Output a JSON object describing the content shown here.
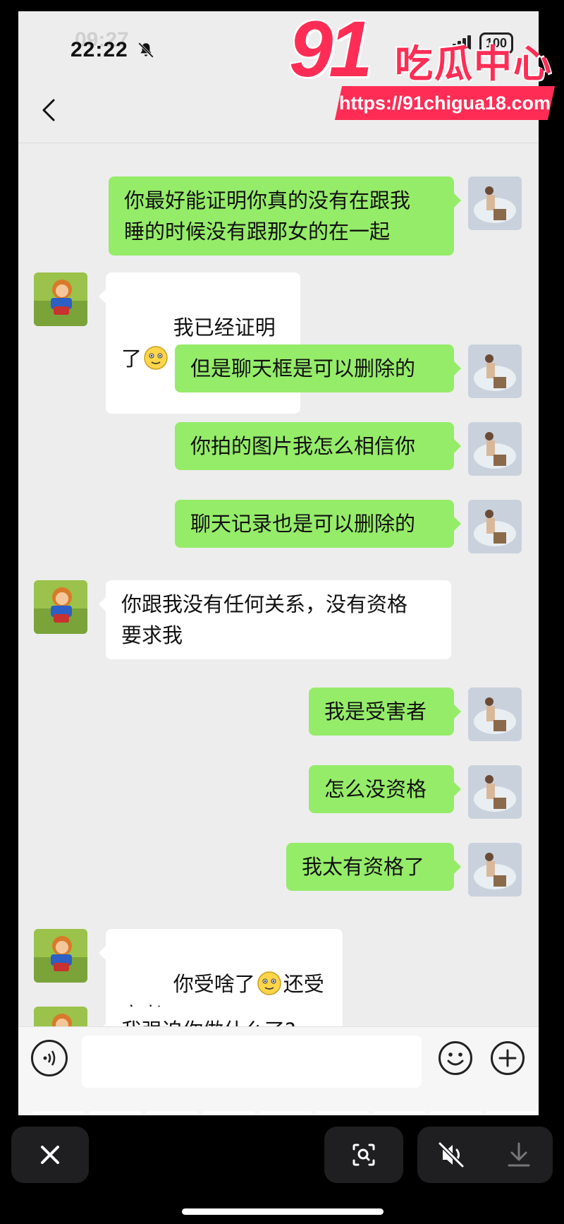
{
  "status": {
    "time": "22:22",
    "time_ghost": "09:27",
    "battery": "100"
  },
  "watermark": {
    "number": "91",
    "text": "吃瓜中心",
    "url": "https://91chigua18.com"
  },
  "messages": [
    {
      "side": "me",
      "text": "你最好能证明你真的没有在跟我\n睡的时候没有跟那女的在一起"
    },
    {
      "side": "them",
      "text": "我已经证明了",
      "emoji_after": "smile"
    },
    {
      "side": "me",
      "text": "但是聊天框是可以删除的"
    },
    {
      "side": "me",
      "text": "你拍的图片我怎么相信你"
    },
    {
      "side": "me",
      "text": "聊天记录也是可以删除的"
    },
    {
      "side": "them",
      "text": "你跟我没有任何关系，没有资格\n要求我"
    },
    {
      "side": "me",
      "text": "我是受害者"
    },
    {
      "side": "me",
      "text": "怎么没资格"
    },
    {
      "side": "me",
      "text": "我太有资格了"
    },
    {
      "side": "them",
      "text_before": "你受啥了",
      "emoji_mid": "smile",
      "text_after": "还受害者"
    },
    {
      "side": "them",
      "text": "我强迫你做什么了?"
    }
  ],
  "input": {
    "placeholder": "",
    "value": ""
  },
  "icons": {
    "back": "chevron-left-icon",
    "voice": "voice-icon",
    "emoji": "emoji-icon",
    "plus": "plus-icon",
    "close": "close-icon",
    "lens": "lens-icon",
    "mute": "mute-icon",
    "download": "download-icon"
  },
  "colors": {
    "me_bubble": "#95ec69",
    "them_bubble": "#ffffff",
    "chat_bg": "#ededed",
    "watermark": "#ff2d55"
  }
}
